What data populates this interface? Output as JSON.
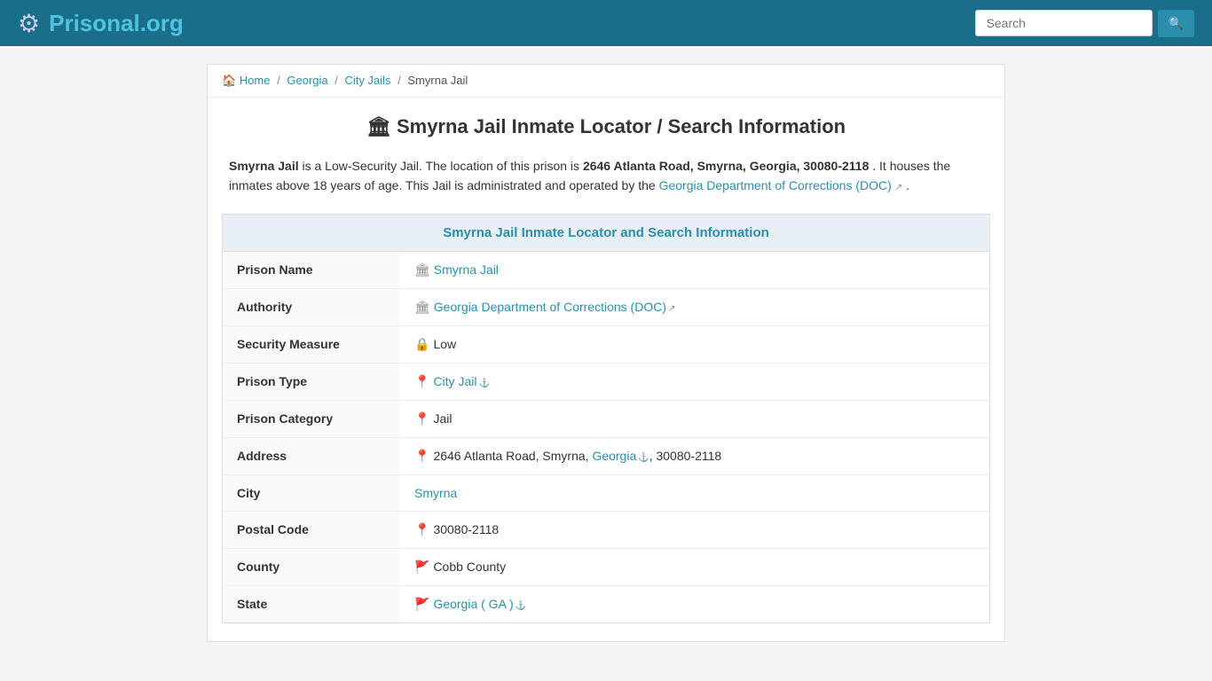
{
  "header": {
    "logo_main": "Prisonal",
    "logo_accent": ".org",
    "search_placeholder": "Search"
  },
  "breadcrumb": {
    "home": "Home",
    "georgia": "Georgia",
    "city_jails": "City Jails",
    "current": "Smyrna Jail"
  },
  "page": {
    "title": "Smyrna Jail Inmate Locator / Search Information",
    "description_start": " is a Low-Security Jail. The location of this prison is ",
    "bold_name": "Smyrna Jail",
    "bold_address": "2646 Atlanta Road, Smyrna, Georgia, 30080-2118",
    "description_mid": ". It houses the inmates above 18 years of age. This Jail is administrated and operated by the ",
    "authority_link": "Georgia Department of Corrections (DOC)",
    "description_end": ".",
    "info_section_title": "Smyrna Jail Inmate Locator and Search Information"
  },
  "table": {
    "rows": [
      {
        "label": "Prison Name",
        "icon": "🏛",
        "value": "Smyrna Jail",
        "link": true
      },
      {
        "label": "Authority",
        "icon": "🏛",
        "value": "Georgia Department of Corrections (DOC)",
        "link": true,
        "ext": true
      },
      {
        "label": "Security Measure",
        "icon": "🔒",
        "value": "Low",
        "link": false
      },
      {
        "label": "Prison Type",
        "icon": "📍",
        "value": "City Jail",
        "link": true,
        "ext": true
      },
      {
        "label": "Prison Category",
        "icon": "📍",
        "value": "Jail",
        "link": false
      },
      {
        "label": "Address",
        "icon": "📍",
        "value_parts": [
          "2646 Atlanta Road, Smyrna, ",
          "Georgia",
          ", 30080-2118"
        ],
        "link_part": "Georgia"
      },
      {
        "label": "City",
        "icon": "",
        "value": "Smyrna",
        "link": true
      },
      {
        "label": "Postal Code",
        "icon": "📍",
        "value": "30080-2118",
        "link": false
      },
      {
        "label": "County",
        "icon": "🚩",
        "value": "Cobb County",
        "link": false
      },
      {
        "label": "State",
        "icon": "🚩",
        "value": "Georgia ( GA )",
        "link": true,
        "ext": true
      }
    ]
  }
}
